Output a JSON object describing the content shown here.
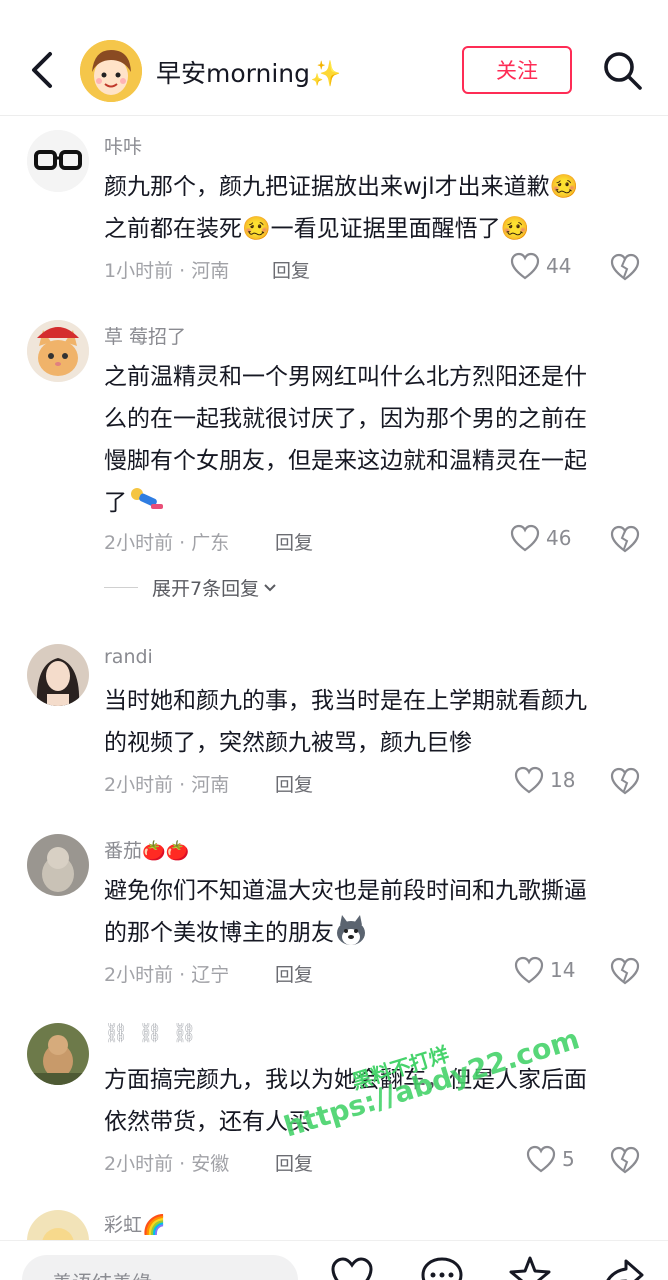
{
  "header": {
    "username": "早安morning",
    "sparkle_glyph": "✨",
    "follow_label": "关注"
  },
  "comments": [
    {
      "user": "咔咔",
      "line1": "颜九那个，颜九把证据放出来wjl才出来道歉🥴",
      "line2": "之前都在装死🥴一看见证据里面醒悟了🥴",
      "meta": "1小时前 · 河南",
      "reply": "回复",
      "likes": "44"
    },
    {
      "user": "草 莓招了",
      "line1": "之前温精灵和一个男网红叫什么北方烈阳还是什",
      "line2": "么的在一起我就很讨厌了，因为那个男的之前在",
      "line3": "慢脚有个女朋友，但是来这边就和温精灵在一起",
      "line4": "了",
      "meta": "2小时前 · 广东",
      "reply": "回复",
      "likes": "46",
      "expand": "展开7条回复"
    },
    {
      "user": "randi",
      "line1": "当时她和颜九的事，我当时是在上学期就看颜九",
      "line2": "的视频了，突然颜九被骂，颜九巨惨",
      "meta": "2小时前 · 河南",
      "reply": "回复",
      "likes": "18"
    },
    {
      "user": "番茄🍅🍅",
      "line1": "避免你们不知道温大灾也是前段时间和九歌撕逼",
      "line2": "的那个美妆博主的朋友",
      "meta": "2小时前 · 辽宁",
      "reply": "回复",
      "likes": "14"
    },
    {
      "user": "⛓⛓⛓",
      "line1": "方面搞完颜九，我以为她会翻车，但是人家后面",
      "line2": "依然带货，还有人买",
      "meta": "2小时前 · 安徽",
      "reply": "回复",
      "likes": "5"
    },
    {
      "user": "彩虹🌈"
    }
  ],
  "input": {
    "placeholder": "善语结善缘"
  },
  "watermark": {
    "url": "https://abdy22.com",
    "top": "黑料不打烊"
  },
  "colors": {
    "accent": "#fe2c55",
    "text": "#161823",
    "meta": "#a1a2a7",
    "watermark": "#46d36b"
  },
  "icons": [
    "back-arrow-icon",
    "search-icon",
    "heart-icon",
    "broken-heart-icon",
    "chevron-down-icon",
    "comment-icon",
    "star-icon",
    "share-icon"
  ]
}
